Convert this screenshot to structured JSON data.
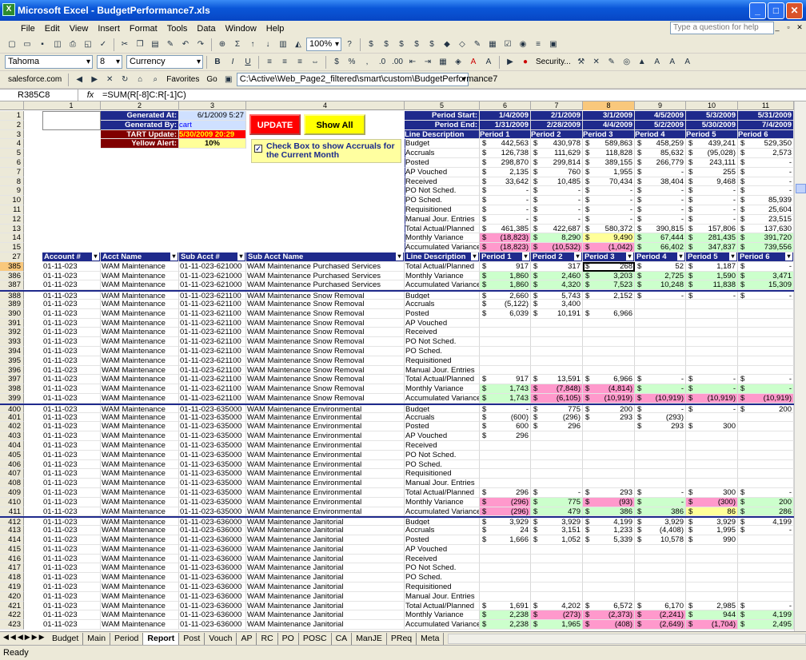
{
  "window": {
    "title": "Microsoft Excel - BudgetPerformance7.xls"
  },
  "menu": [
    "File",
    "Edit",
    "View",
    "Insert",
    "Format",
    "Tools",
    "Data",
    "Window",
    "Help"
  ],
  "ask_placeholder": "Type a question for help",
  "toolbar": {
    "zoom": "100%",
    "font": "Tahoma",
    "size": "8",
    "style": "Currency",
    "security": "Security...",
    "salesforce": "salesforce.com",
    "favorites": "Favorites",
    "go": "Go",
    "path": "C:\\Active\\Web_Page2_filtered\\smart\\custom\\BudgetPerformance7"
  },
  "formula": {
    "namebox": "R385C8",
    "fx": "fx",
    "value": "=SUM(R[-8]C:R[-1]C)"
  },
  "columns": [
    "1",
    "2",
    "3",
    "4",
    "5",
    "6",
    "7",
    "8",
    "9",
    "10",
    "11"
  ],
  "header": {
    "generated_at_label": "Generated At:",
    "generated_at": "6/1/2009 5:27",
    "generated_by_label": "Generated By:",
    "generated_by": "cart",
    "tart_label": "TART Update:",
    "tart": "5/30/2009 20:29",
    "yellow_label": "Yellow Alert:",
    "yellow": "10%",
    "update": "UPDATE",
    "show_all": "Show All",
    "checkbox_label": "Check Box to show Accruals for the Current Month",
    "period_start_label": "Period Start:",
    "period_end_label": "Period End:",
    "line_desc": "Line Description",
    "period_start": [
      "1/4/2009",
      "2/1/2009",
      "3/1/2009",
      "4/5/2009",
      "5/3/2009",
      "5/31/2009"
    ],
    "period_end": [
      "1/31/2009",
      "2/28/2009",
      "4/4/2009",
      "5/2/2009",
      "5/30/2009",
      "7/4/2009"
    ],
    "periods": [
      "Period 1",
      "Period 2",
      "Period 3",
      "Period 4",
      "Period 5",
      "Period 6"
    ]
  },
  "summary": [
    {
      "r": "4",
      "label": "Budget",
      "v": [
        "442,563",
        "430,978",
        "589,863",
        "458,259",
        "439,241",
        "529,350"
      ]
    },
    {
      "r": "5",
      "label": "Accruals",
      "v": [
        "126,738",
        "111,629",
        "118,828",
        "85,632",
        "(95,028)",
        "2,573"
      ]
    },
    {
      "r": "6",
      "label": "Posted",
      "v": [
        "298,870",
        "299,814",
        "389,155",
        "266,779",
        "243,111",
        "-"
      ]
    },
    {
      "r": "7",
      "label": "AP Vouched",
      "v": [
        "2,135",
        "760",
        "1,955",
        "-",
        "255",
        "-"
      ]
    },
    {
      "r": "8",
      "label": "Received",
      "v": [
        "33,642",
        "10,485",
        "70,434",
        "38,404",
        "9,468",
        "-"
      ]
    },
    {
      "r": "9",
      "label": "PO Not Sched.",
      "v": [
        "-",
        "-",
        "-",
        "-",
        "-",
        "-"
      ]
    },
    {
      "r": "10",
      "label": "PO Sched.",
      "v": [
        "-",
        "-",
        "-",
        "-",
        "-",
        "85,939"
      ]
    },
    {
      "r": "11",
      "label": "Requisitioned",
      "v": [
        "-",
        "-",
        "-",
        "-",
        "-",
        "25,604"
      ]
    },
    {
      "r": "12",
      "label": "Manual Jour. Entries",
      "v": [
        "-",
        "-",
        "-",
        "-",
        "-",
        "23,515"
      ]
    },
    {
      "r": "13",
      "label": "Total Actual/Planned",
      "v": [
        "461,385",
        "422,687",
        "580,372",
        "390,815",
        "157,806",
        "137,630"
      ]
    },
    {
      "r": "14",
      "label": "Monthly Variance",
      "v": [
        "(18,823)",
        "8,290",
        "9,490",
        "67,444",
        "281,435",
        "391,720"
      ]
    },
    {
      "r": "15",
      "label": "Accumulated Variance",
      "v": [
        "(18,823)",
        "(10,532)",
        "(1,042)",
        "66,402",
        "347,837",
        "739,556"
      ]
    }
  ],
  "table_headers": [
    "Account #",
    "Acct Name",
    "Sub Acct #",
    "Sub Acct Name",
    "Line Description",
    "Period 1",
    "Period 2",
    "Period 3",
    "Period 4",
    "Period 5",
    "Period 6"
  ],
  "table_header_row": "27",
  "detail": [
    {
      "r": "385",
      "a": "01-11-023",
      "n": "WAM Maintenance",
      "s": "01-11-023-621000",
      "sn": "WAM Maintenance Purchased Services",
      "l": "Total Actual/Planned",
      "v": [
        "917",
        "317",
        "268",
        "52",
        "1,187",
        "-"
      ]
    },
    {
      "r": "386",
      "a": "01-11-023",
      "n": "WAM Maintenance",
      "s": "01-11-023-621000",
      "sn": "WAM Maintenance Purchased Services",
      "l": "Monthly Variance",
      "v": [
        "1,860",
        "2,460",
        "3,203",
        "2,725",
        "1,590",
        "3,471"
      ]
    },
    {
      "r": "387",
      "a": "01-11-023",
      "n": "WAM Maintenance",
      "s": "01-11-023-621000",
      "sn": "WAM Maintenance Purchased Services",
      "l": "Accumulated Variance",
      "v": [
        "1,860",
        "4,320",
        "7,523",
        "10,248",
        "11,838",
        "15,309"
      ]
    },
    {
      "r": "388",
      "a": "01-11-023",
      "n": "WAM Maintenance",
      "s": "01-11-023-621100",
      "sn": "WAM Maintenance Snow Removal",
      "l": "Budget",
      "v": [
        "2,660",
        "5,743",
        "2,152",
        "-",
        "-",
        "-"
      ]
    },
    {
      "r": "389",
      "a": "01-11-023",
      "n": "WAM Maintenance",
      "s": "01-11-023-621100",
      "sn": "WAM Maintenance Snow Removal",
      "l": "Accruals",
      "v": [
        "(5,122)",
        "3,400",
        "",
        "",
        "",
        ""
      ]
    },
    {
      "r": "390",
      "a": "01-11-023",
      "n": "WAM Maintenance",
      "s": "01-11-023-621100",
      "sn": "WAM Maintenance Snow Removal",
      "l": "Posted",
      "v": [
        "6,039",
        "10,191",
        "6,966",
        "",
        "",
        ""
      ]
    },
    {
      "r": "391",
      "a": "01-11-023",
      "n": "WAM Maintenance",
      "s": "01-11-023-621100",
      "sn": "WAM Maintenance Snow Removal",
      "l": "AP Vouched",
      "v": [
        "",
        "",
        "",
        "",
        "",
        ""
      ]
    },
    {
      "r": "392",
      "a": "01-11-023",
      "n": "WAM Maintenance",
      "s": "01-11-023-621100",
      "sn": "WAM Maintenance Snow Removal",
      "l": "Received",
      "v": [
        "",
        "",
        "",
        "",
        "",
        ""
      ]
    },
    {
      "r": "393",
      "a": "01-11-023",
      "n": "WAM Maintenance",
      "s": "01-11-023-621100",
      "sn": "WAM Maintenance Snow Removal",
      "l": "PO Not Sched.",
      "v": [
        "",
        "",
        "",
        "",
        "",
        ""
      ]
    },
    {
      "r": "394",
      "a": "01-11-023",
      "n": "WAM Maintenance",
      "s": "01-11-023-621100",
      "sn": "WAM Maintenance Snow Removal",
      "l": "PO Sched.",
      "v": [
        "",
        "",
        "",
        "",
        "",
        ""
      ]
    },
    {
      "r": "395",
      "a": "01-11-023",
      "n": "WAM Maintenance",
      "s": "01-11-023-621100",
      "sn": "WAM Maintenance Snow Removal",
      "l": "Requisitioned",
      "v": [
        "",
        "",
        "",
        "",
        "",
        ""
      ]
    },
    {
      "r": "396",
      "a": "01-11-023",
      "n": "WAM Maintenance",
      "s": "01-11-023-621100",
      "sn": "WAM Maintenance Snow Removal",
      "l": "Manual Jour. Entries",
      "v": [
        "",
        "",
        "",
        "",
        "",
        ""
      ]
    },
    {
      "r": "397",
      "a": "01-11-023",
      "n": "WAM Maintenance",
      "s": "01-11-023-621100",
      "sn": "WAM Maintenance Snow Removal",
      "l": "Total Actual/Planned",
      "v": [
        "917",
        "13,591",
        "6,966",
        "-",
        "-",
        "-"
      ]
    },
    {
      "r": "398",
      "a": "01-11-023",
      "n": "WAM Maintenance",
      "s": "01-11-023-621100",
      "sn": "WAM Maintenance Snow Removal",
      "l": "Monthly Variance",
      "v": [
        "1,743",
        "(7,848)",
        "(4,814)",
        "-",
        "-",
        "-"
      ]
    },
    {
      "r": "399",
      "a": "01-11-023",
      "n": "WAM Maintenance",
      "s": "01-11-023-621100",
      "sn": "WAM Maintenance Snow Removal",
      "l": "Accumulated Variance",
      "v": [
        "1,743",
        "(6,105)",
        "(10,919)",
        "(10,919)",
        "(10,919)",
        "(10,919)"
      ]
    },
    {
      "r": "400",
      "a": "01-11-023",
      "n": "WAM Maintenance",
      "s": "01-11-023-635000",
      "sn": "WAM Maintenance Environmental",
      "l": "Budget",
      "v": [
        "-",
        "775",
        "200",
        "-",
        "-",
        "200"
      ]
    },
    {
      "r": "401",
      "a": "01-11-023",
      "n": "WAM Maintenance",
      "s": "01-11-023-635000",
      "sn": "WAM Maintenance Environmental",
      "l": "Accruals",
      "v": [
        "(600)",
        "(296)",
        "293",
        "(293)",
        "",
        ""
      ]
    },
    {
      "r": "402",
      "a": "01-11-023",
      "n": "WAM Maintenance",
      "s": "01-11-023-635000",
      "sn": "WAM Maintenance Environmental",
      "l": "Posted",
      "v": [
        "600",
        "296",
        "",
        "293",
        "300",
        ""
      ]
    },
    {
      "r": "403",
      "a": "01-11-023",
      "n": "WAM Maintenance",
      "s": "01-11-023-635000",
      "sn": "WAM Maintenance Environmental",
      "l": "AP Vouched",
      "v": [
        "296",
        "",
        "",
        "",
        "",
        ""
      ]
    },
    {
      "r": "404",
      "a": "01-11-023",
      "n": "WAM Maintenance",
      "s": "01-11-023-635000",
      "sn": "WAM Maintenance Environmental",
      "l": "Received",
      "v": [
        "",
        "",
        "",
        "",
        "",
        ""
      ]
    },
    {
      "r": "405",
      "a": "01-11-023",
      "n": "WAM Maintenance",
      "s": "01-11-023-635000",
      "sn": "WAM Maintenance Environmental",
      "l": "PO Not Sched.",
      "v": [
        "",
        "",
        "",
        "",
        "",
        ""
      ]
    },
    {
      "r": "406",
      "a": "01-11-023",
      "n": "WAM Maintenance",
      "s": "01-11-023-635000",
      "sn": "WAM Maintenance Environmental",
      "l": "PO Sched.",
      "v": [
        "",
        "",
        "",
        "",
        "",
        ""
      ]
    },
    {
      "r": "407",
      "a": "01-11-023",
      "n": "WAM Maintenance",
      "s": "01-11-023-635000",
      "sn": "WAM Maintenance Environmental",
      "l": "Requisitioned",
      "v": [
        "",
        "",
        "",
        "",
        "",
        ""
      ]
    },
    {
      "r": "408",
      "a": "01-11-023",
      "n": "WAM Maintenance",
      "s": "01-11-023-635000",
      "sn": "WAM Maintenance Environmental",
      "l": "Manual Jour. Entries",
      "v": [
        "",
        "",
        "",
        "",
        "",
        ""
      ]
    },
    {
      "r": "409",
      "a": "01-11-023",
      "n": "WAM Maintenance",
      "s": "01-11-023-635000",
      "sn": "WAM Maintenance Environmental",
      "l": "Total Actual/Planned",
      "v": [
        "296",
        "-",
        "293",
        "-",
        "300",
        "-"
      ]
    },
    {
      "r": "410",
      "a": "01-11-023",
      "n": "WAM Maintenance",
      "s": "01-11-023-635000",
      "sn": "WAM Maintenance Environmental",
      "l": "Monthly Variance",
      "v": [
        "(296)",
        "775",
        "(93)",
        "-",
        "(300)",
        "200"
      ]
    },
    {
      "r": "411",
      "a": "01-11-023",
      "n": "WAM Maintenance",
      "s": "01-11-023-635000",
      "sn": "WAM Maintenance Environmental",
      "l": "Accumulated Variance",
      "v": [
        "(296)",
        "479",
        "386",
        "386",
        "86",
        "286"
      ]
    },
    {
      "r": "412",
      "a": "01-11-023",
      "n": "WAM Maintenance",
      "s": "01-11-023-636000",
      "sn": "WAM Maintenance Janitorial",
      "l": "Budget",
      "v": [
        "3,929",
        "3,929",
        "4,199",
        "3,929",
        "3,929",
        "4,199"
      ]
    },
    {
      "r": "413",
      "a": "01-11-023",
      "n": "WAM Maintenance",
      "s": "01-11-023-636000",
      "sn": "WAM Maintenance Janitorial",
      "l": "Accruals",
      "v": [
        "24",
        "3,151",
        "1,233",
        "(4,408)",
        "1,995",
        "-"
      ]
    },
    {
      "r": "414",
      "a": "01-11-023",
      "n": "WAM Maintenance",
      "s": "01-11-023-636000",
      "sn": "WAM Maintenance Janitorial",
      "l": "Posted",
      "v": [
        "1,666",
        "1,052",
        "5,339",
        "10,578",
        "990",
        ""
      ]
    },
    {
      "r": "415",
      "a": "01-11-023",
      "n": "WAM Maintenance",
      "s": "01-11-023-636000",
      "sn": "WAM Maintenance Janitorial",
      "l": "AP Vouched",
      "v": [
        "",
        "",
        "",
        "",
        "",
        ""
      ]
    },
    {
      "r": "416",
      "a": "01-11-023",
      "n": "WAM Maintenance",
      "s": "01-11-023-636000",
      "sn": "WAM Maintenance Janitorial",
      "l": "Received",
      "v": [
        "",
        "",
        "",
        "",
        "",
        ""
      ]
    },
    {
      "r": "417",
      "a": "01-11-023",
      "n": "WAM Maintenance",
      "s": "01-11-023-636000",
      "sn": "WAM Maintenance Janitorial",
      "l": "PO Not Sched.",
      "v": [
        "",
        "",
        "",
        "",
        "",
        ""
      ]
    },
    {
      "r": "418",
      "a": "01-11-023",
      "n": "WAM Maintenance",
      "s": "01-11-023-636000",
      "sn": "WAM Maintenance Janitorial",
      "l": "PO Sched.",
      "v": [
        "",
        "",
        "",
        "",
        "",
        ""
      ]
    },
    {
      "r": "419",
      "a": "01-11-023",
      "n": "WAM Maintenance",
      "s": "01-11-023-636000",
      "sn": "WAM Maintenance Janitorial",
      "l": "Requisitioned",
      "v": [
        "",
        "",
        "",
        "",
        "",
        ""
      ]
    },
    {
      "r": "420",
      "a": "01-11-023",
      "n": "WAM Maintenance",
      "s": "01-11-023-636000",
      "sn": "WAM Maintenance Janitorial",
      "l": "Manual Jour. Entries",
      "v": [
        "",
        "",
        "",
        "",
        "",
        ""
      ]
    },
    {
      "r": "421",
      "a": "01-11-023",
      "n": "WAM Maintenance",
      "s": "01-11-023-636000",
      "sn": "WAM Maintenance Janitorial",
      "l": "Total Actual/Planned",
      "v": [
        "1,691",
        "4,202",
        "6,572",
        "6,170",
        "2,985",
        "-"
      ]
    },
    {
      "r": "422",
      "a": "01-11-023",
      "n": "WAM Maintenance",
      "s": "01-11-023-636000",
      "sn": "WAM Maintenance Janitorial",
      "l": "Monthly Variance",
      "v": [
        "2,238",
        "(273)",
        "(2,373)",
        "(2,241)",
        "944",
        "4,199"
      ]
    },
    {
      "r": "423",
      "a": "01-11-023",
      "n": "WAM Maintenance",
      "s": "01-11-023-636000",
      "sn": "WAM Maintenance Janitorial",
      "l": "Accumulated Variance",
      "v": [
        "2,238",
        "1,965",
        "(408)",
        "(2,649)",
        "(1,704)",
        "2,495"
      ]
    }
  ],
  "tabs": [
    "Budget",
    "Main",
    "Period",
    "Report",
    "Post",
    "Vouch",
    "AP",
    "RC",
    "PO",
    "POSC",
    "CA",
    "ManJE",
    "PReq",
    "Meta"
  ],
  "active_tab": "Report",
  "status": "Ready",
  "colors": {
    "navy": "#1f2a8c",
    "green": "#ccffcc",
    "pink": "#ff99cc",
    "yellow": "#ffff99",
    "red": "#ff0000",
    "maroon": "#800000"
  }
}
